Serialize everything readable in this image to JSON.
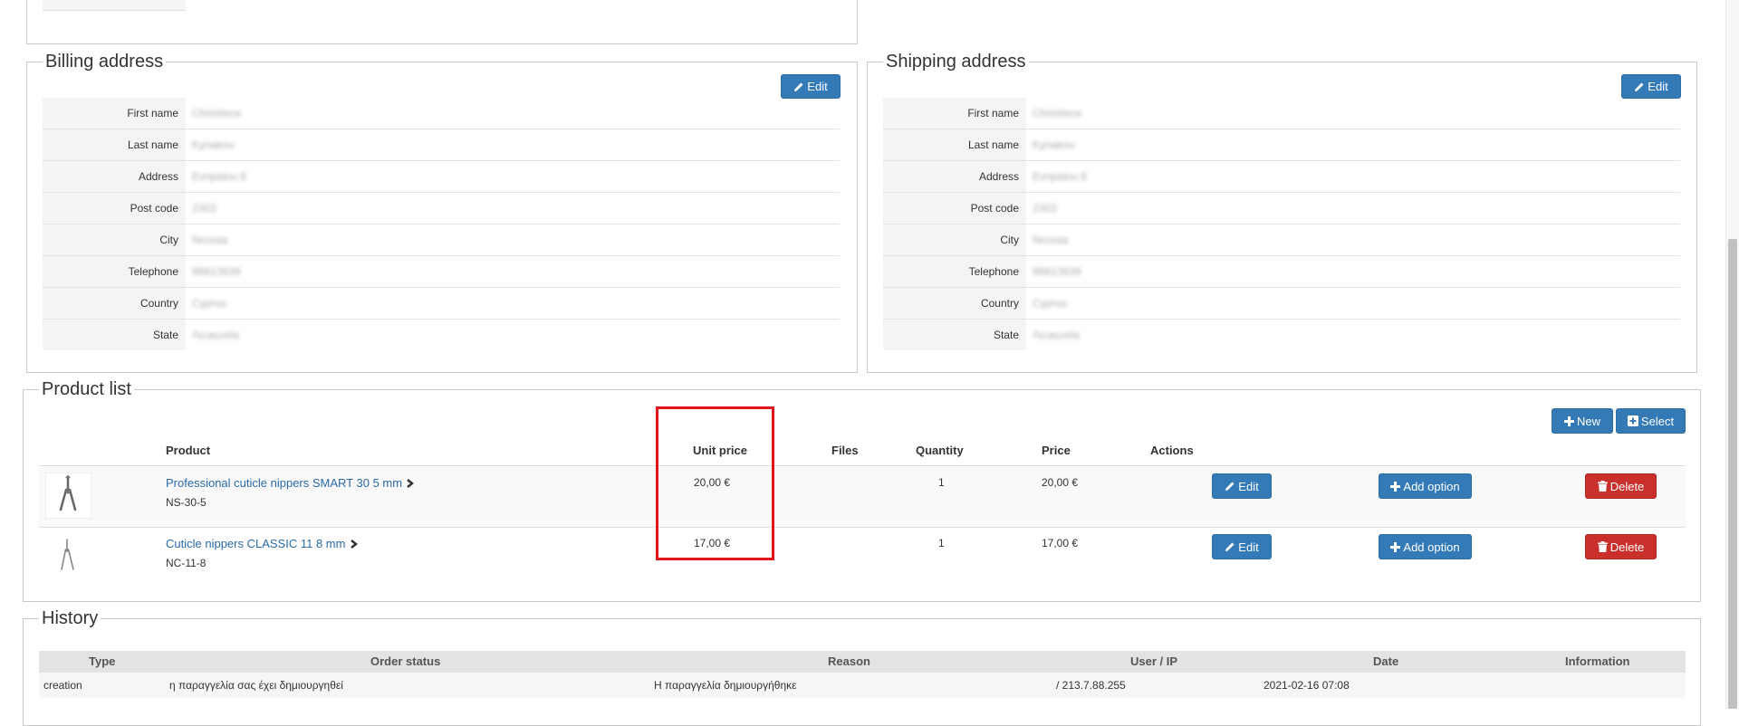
{
  "billing": {
    "title": "Billing address",
    "edit_label": "Edit",
    "rows": [
      {
        "label": "First name",
        "value": "Christiana"
      },
      {
        "label": "Last name",
        "value": "Kyriakou"
      },
      {
        "label": "Address",
        "value": "Evripidou 8"
      },
      {
        "label": "Post code",
        "value": "2303"
      },
      {
        "label": "City",
        "value": "Nicosia"
      },
      {
        "label": "Telephone",
        "value": "99813939"
      },
      {
        "label": "Country",
        "value": "Cyprus"
      },
      {
        "label": "State",
        "value": "Λευκωσία"
      }
    ]
  },
  "shipping": {
    "title": "Shipping address",
    "edit_label": "Edit",
    "rows": [
      {
        "label": "First name",
        "value": "Christiana"
      },
      {
        "label": "Last name",
        "value": "Kyriakou"
      },
      {
        "label": "Address",
        "value": "Evripidou 8"
      },
      {
        "label": "Post code",
        "value": "2303"
      },
      {
        "label": "City",
        "value": "Nicosia"
      },
      {
        "label": "Telephone",
        "value": "99813939"
      },
      {
        "label": "Country",
        "value": "Cyprus"
      },
      {
        "label": "State",
        "value": "Λευκωσία"
      }
    ]
  },
  "products": {
    "title": "Product list",
    "new_label": "New",
    "select_label": "Select",
    "columns": {
      "product": "Product",
      "unit_price": "Unit price",
      "files": "Files",
      "quantity": "Quantity",
      "price": "Price",
      "actions": "Actions"
    },
    "rows": [
      {
        "name": "Professional cuticle nippers SMART 30 5 mm",
        "sku": "NS-30-5",
        "unit_price": "20,00 €",
        "quantity": "1",
        "price": "20,00 €",
        "edit_label": "Edit",
        "add_option_label": "Add option",
        "delete_label": "Delete"
      },
      {
        "name": "Cuticle nippers CLASSIC 11 8 mm",
        "sku": "NC-11-8",
        "unit_price": "17,00 €",
        "quantity": "1",
        "price": "17,00 €",
        "edit_label": "Edit",
        "add_option_label": "Add option",
        "delete_label": "Delete"
      }
    ]
  },
  "history": {
    "title": "History",
    "columns": {
      "type": "Type",
      "order_status": "Order status",
      "reason": "Reason",
      "user_ip": "User / IP",
      "date": "Date",
      "information": "Information"
    },
    "rows": [
      {
        "type": "creation",
        "order_status": "η παραγγελία σας έχει δημιουργηθεί",
        "reason": "Η παραγγελία δημιουργήθηκε",
        "user_ip": "/ 213.7.88.255",
        "date": "2021-02-16 07:08",
        "information": ""
      }
    ]
  },
  "colors": {
    "primary_button": "#337ab7",
    "danger_button": "#c9302c",
    "link": "#2a6aa9",
    "highlight_box": "#e0161b"
  },
  "icons": {
    "edit": "pencil-icon",
    "new": "plus-icon",
    "select": "plus-square-icon",
    "add_option": "plus-icon",
    "delete": "trash-icon",
    "product_link": "chevron-right-icon"
  }
}
